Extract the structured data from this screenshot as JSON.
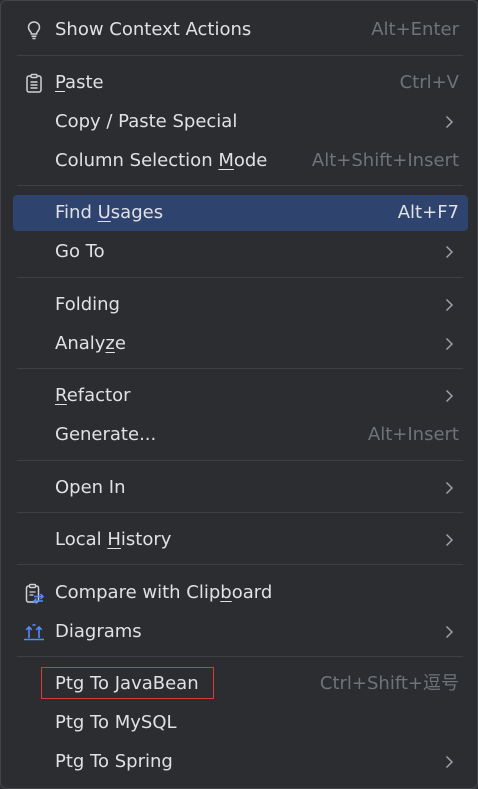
{
  "colors": {
    "background": "#2b2d30",
    "text": "#dfe1e5",
    "shortcut_text": "#6f737a",
    "selected_background": "#2e436e",
    "separator": "#3e4045",
    "highlight_border": "#d83a3a",
    "icon": "#cfd1d6"
  },
  "menu": {
    "show_context_actions": {
      "label": "Show Context Actions",
      "shortcut": "Alt+Enter",
      "icon": "lightbulb-icon"
    },
    "paste": {
      "pre": "",
      "mnemonic": "P",
      "post": "aste",
      "shortcut": "Ctrl+V",
      "icon": "clipboard-icon"
    },
    "copy_paste_special": {
      "label": "Copy / Paste Special",
      "submenu": true
    },
    "column_selection_mode": {
      "pre": "Column Selection ",
      "mnemonic": "M",
      "post": "ode",
      "shortcut": "Alt+Shift+Insert"
    },
    "find_usages": {
      "pre": "Find ",
      "mnemonic": "U",
      "post": "sages",
      "shortcut": "Alt+F7",
      "selected": true
    },
    "go_to": {
      "label": "Go To",
      "submenu": true
    },
    "folding": {
      "label": "Folding",
      "submenu": true
    },
    "analyze": {
      "pre": "Analy",
      "mnemonic": "z",
      "post": "e",
      "submenu": true
    },
    "refactor": {
      "pre": "",
      "mnemonic": "R",
      "post": "efactor",
      "submenu": true
    },
    "generate": {
      "label": "Generate...",
      "shortcut": "Alt+Insert"
    },
    "open_in": {
      "label": "Open In",
      "submenu": true
    },
    "local_history": {
      "pre": "Local ",
      "mnemonic": "H",
      "post": "istory",
      "submenu": true
    },
    "compare_with_clipboard": {
      "pre": "Compare with Clip",
      "mnemonic": "b",
      "post": "oard",
      "icon": "compare-clipboard-icon"
    },
    "diagrams": {
      "label": "Diagrams",
      "submenu": true,
      "icon": "diagram-icon"
    },
    "ptg_to_javabean": {
      "label": "Ptg To JavaBean",
      "shortcut": "Ctrl+Shift+逗号",
      "outlined": true
    },
    "ptg_to_mysql": {
      "label": "Ptg To MySQL"
    },
    "ptg_to_spring": {
      "label": "Ptg To Spring",
      "submenu": true
    }
  }
}
